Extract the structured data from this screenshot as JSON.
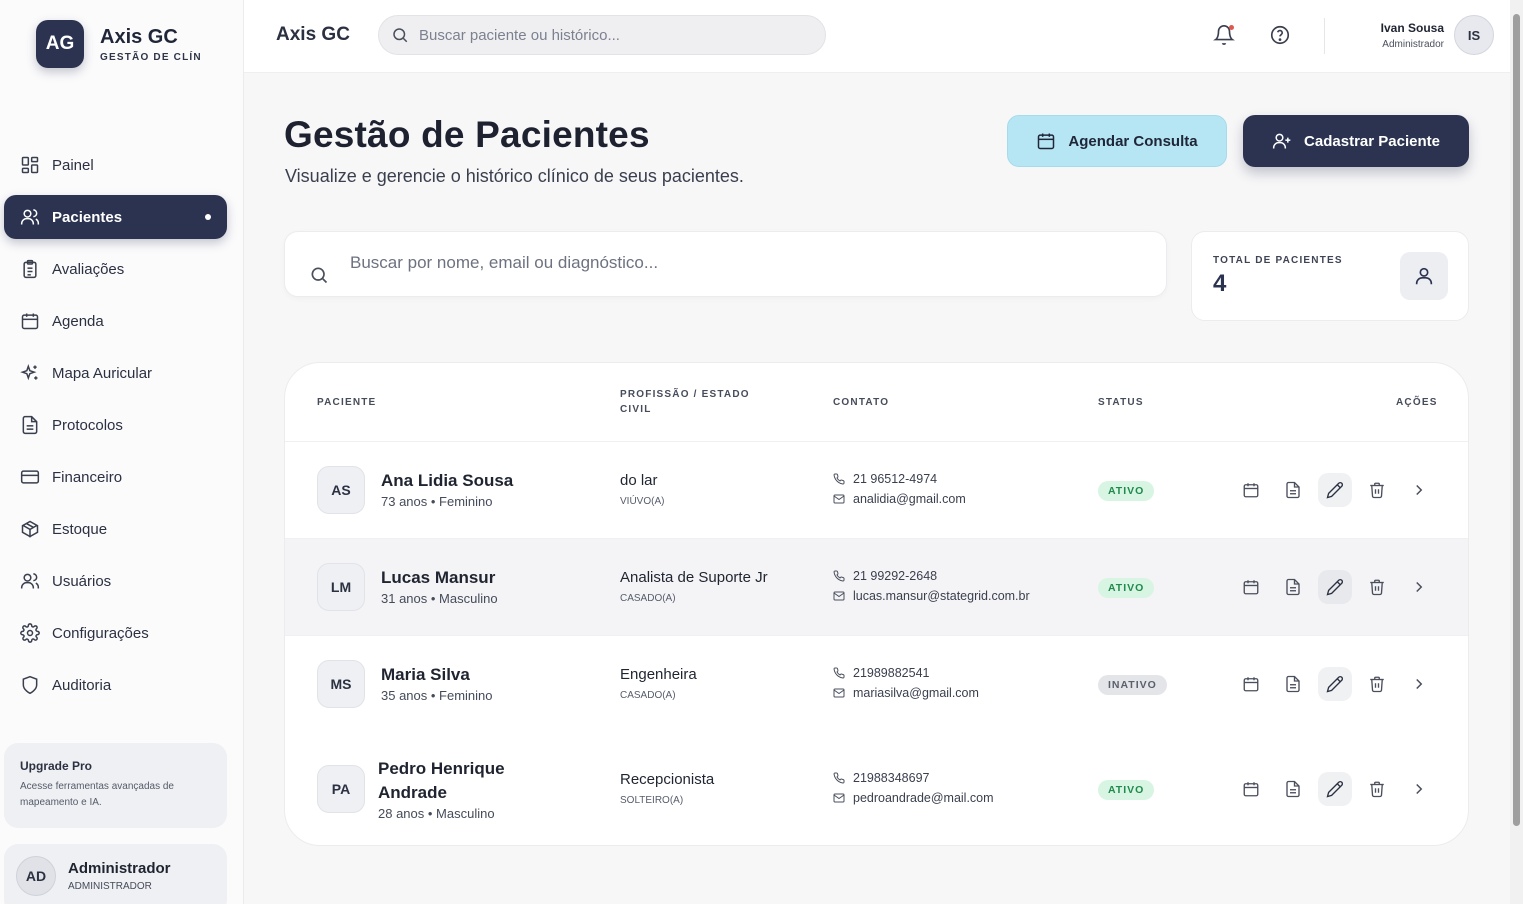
{
  "brand": {
    "logo": "AG",
    "name": "Axis GC",
    "subtitle": "GESTÃO DE CLÍN"
  },
  "sidebar": {
    "items": [
      {
        "label": "Painel",
        "icon": "dashboard-icon"
      },
      {
        "label": "Pacientes",
        "icon": "users-icon",
        "active": true
      },
      {
        "label": "Avaliações",
        "icon": "clipboard-icon"
      },
      {
        "label": "Agenda",
        "icon": "calendar-icon"
      },
      {
        "label": "Mapa Auricular",
        "icon": "sparkles-icon"
      },
      {
        "label": "Protocolos",
        "icon": "document-icon"
      },
      {
        "label": "Financeiro",
        "icon": "credit-card-icon"
      },
      {
        "label": "Estoque",
        "icon": "box-icon"
      },
      {
        "label": "Usuários",
        "icon": "users-icon"
      },
      {
        "label": "Configurações",
        "icon": "gear-icon"
      },
      {
        "label": "Auditoria",
        "icon": "shield-icon"
      }
    ],
    "upgrade": {
      "title": "Upgrade Pro",
      "text": "Acesse ferramentas avançadas de mapeamento e IA."
    },
    "user": {
      "initials": "AD",
      "name": "Administrador",
      "role": "ADMINISTRADOR"
    }
  },
  "header": {
    "title": "Axis GC",
    "search_placeholder": "Buscar paciente ou histórico...",
    "user": {
      "name": "Ivan Sousa",
      "role": "Administrador",
      "initials": "IS"
    }
  },
  "main": {
    "title": "Gestão de Pacientes",
    "subtitle": "Visualize e gerencie o histórico clínico de seus pacientes.",
    "schedule_button": "Agendar Consulta",
    "create_button": "Cadastrar Paciente",
    "search_placeholder": "Buscar por nome, email ou diagnóstico...",
    "stat": {
      "label": "TOTAL DE PACIENTES",
      "value": "4"
    }
  },
  "table": {
    "headers": {
      "patient": "PACIENTE",
      "profession_l1": "PROFISSÃO / ESTADO",
      "profession_l2": "CIVIL",
      "contact": "CONTATO",
      "status": "STATUS",
      "actions": "AÇÕES"
    },
    "rows": [
      {
        "initials": "AS",
        "name": "Ana Lidia Sousa",
        "name_l2": "",
        "meta": "73 anos • Feminino",
        "profession": "do lar",
        "civil": "VIÚVO(A)",
        "phone": "21 96512-4974",
        "email": "analidia@gmail.com",
        "status": "ATIVO"
      },
      {
        "initials": "LM",
        "name": "Lucas Mansur",
        "name_l2": "",
        "meta": "31 anos • Masculino",
        "profession": "Analista de Suporte Jr",
        "civil": "CASADO(A)",
        "phone": "21 99292-2648",
        "email": "lucas.mansur@stategrid.com.br",
        "status": "ATIVO"
      },
      {
        "initials": "MS",
        "name": "Maria Silva",
        "name_l2": "",
        "meta": "35 anos • Feminino",
        "profession": "Engenheira",
        "civil": "CASADO(A)",
        "phone": "21989882541",
        "email": "mariasilva@gmail.com",
        "status": "INATIVO"
      },
      {
        "initials": "PA",
        "name": "Pedro Henrique",
        "name_l2": "Andrade",
        "meta": "28 anos • Masculino",
        "profession": "Recepcionista",
        "civil": "SOLTEIRO(A)",
        "phone": "21988348697",
        "email": "pedroandrade@mail.com",
        "status": "ATIVO"
      }
    ]
  }
}
